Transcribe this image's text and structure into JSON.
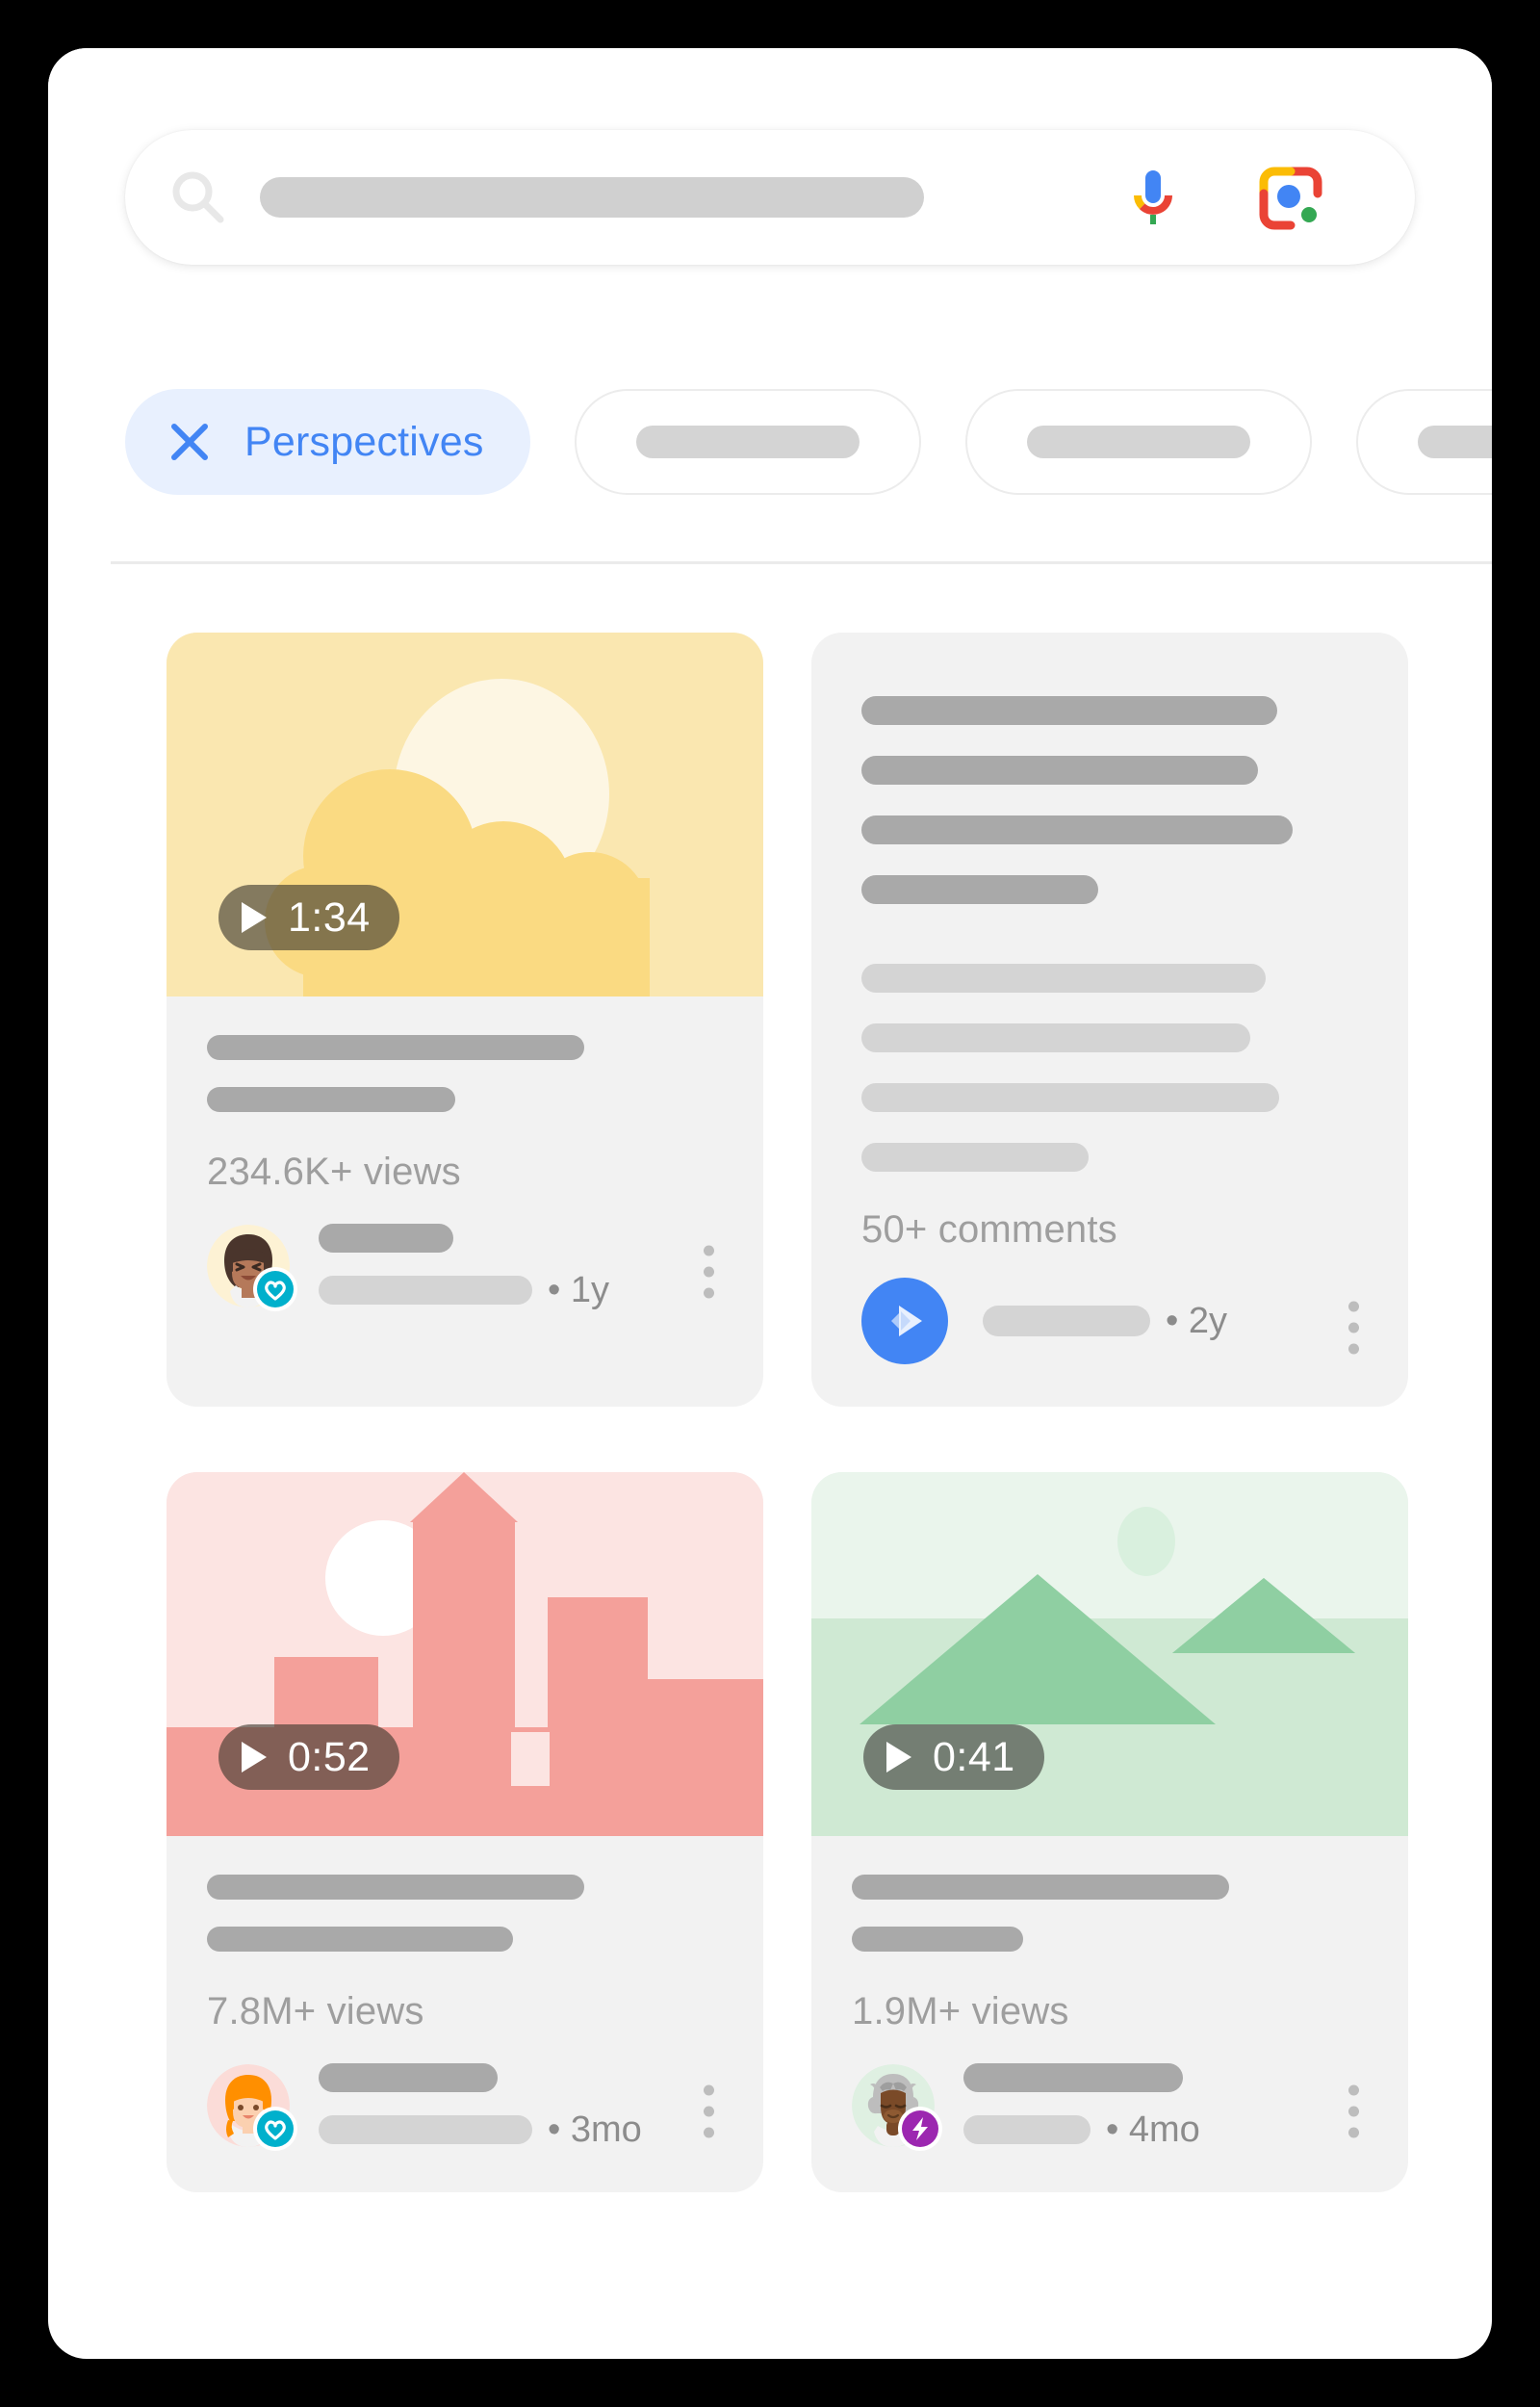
{
  "search": {
    "icon": "search-icon",
    "query_value": "",
    "placeholder": "",
    "mic_icon": "microphone-icon",
    "lens_icon": "google-lens-icon"
  },
  "filters": {
    "active_chip": {
      "label": "Perspectives",
      "icon": "close-x-icon",
      "accent_color": "#4285f4",
      "background_color": "#e8f0fe"
    },
    "placeholder_chips": [
      {
        "label": ""
      },
      {
        "label": ""
      },
      {
        "label": ""
      }
    ]
  },
  "results": [
    {
      "type": "video",
      "thumbnail": "sun-and-clouds-illustration",
      "thumbnail_colors": {
        "sky": "#fae7b0",
        "sun": "#fdf6e3",
        "cloud": "#fada82"
      },
      "duration": "1:34",
      "views": "234.6K+ views",
      "title_placeholder": "",
      "source_placeholder": "",
      "age": "• 1y",
      "avatar": "woman-avatar",
      "badge": "heart-verified-badge",
      "badge_color": "#00b0cc",
      "menu_icon": "three-dot-menu-icon"
    },
    {
      "type": "text",
      "comments": "50+ comments",
      "body_placeholder": "",
      "source_placeholder": "",
      "age": "• 2y",
      "avatar": "blue-play-star-icon",
      "badge_color": "#4285f4",
      "menu_icon": "three-dot-menu-icon"
    },
    {
      "type": "video",
      "thumbnail": "pink-cityscape-illustration",
      "thumbnail_colors": {
        "sky": "#fce4e2",
        "buildings": "#f4a09a",
        "moon": "#ffffff"
      },
      "duration": "0:52",
      "views": "7.8M+ views",
      "title_placeholder": "",
      "source_placeholder": "",
      "age": "• 3mo",
      "avatar": "red-haired-woman-avatar",
      "badge": "heart-verified-badge",
      "badge_color": "#00b0cc",
      "menu_icon": "three-dot-menu-icon"
    },
    {
      "type": "video",
      "thumbnail": "green-mountains-illustration",
      "thumbnail_colors": {
        "sky": "#e8f5e9",
        "ground": "#cfe9d3",
        "mountain": "#8fcfa2"
      },
      "duration": "0:41",
      "views": "1.9M+ views",
      "title_placeholder": "",
      "source_placeholder": "",
      "age": "• 4mo",
      "avatar": "ox-avatar",
      "badge": "lightning-bolt-badge",
      "badge_color": "#9c27b0",
      "menu_icon": "three-dot-menu-icon"
    }
  ]
}
